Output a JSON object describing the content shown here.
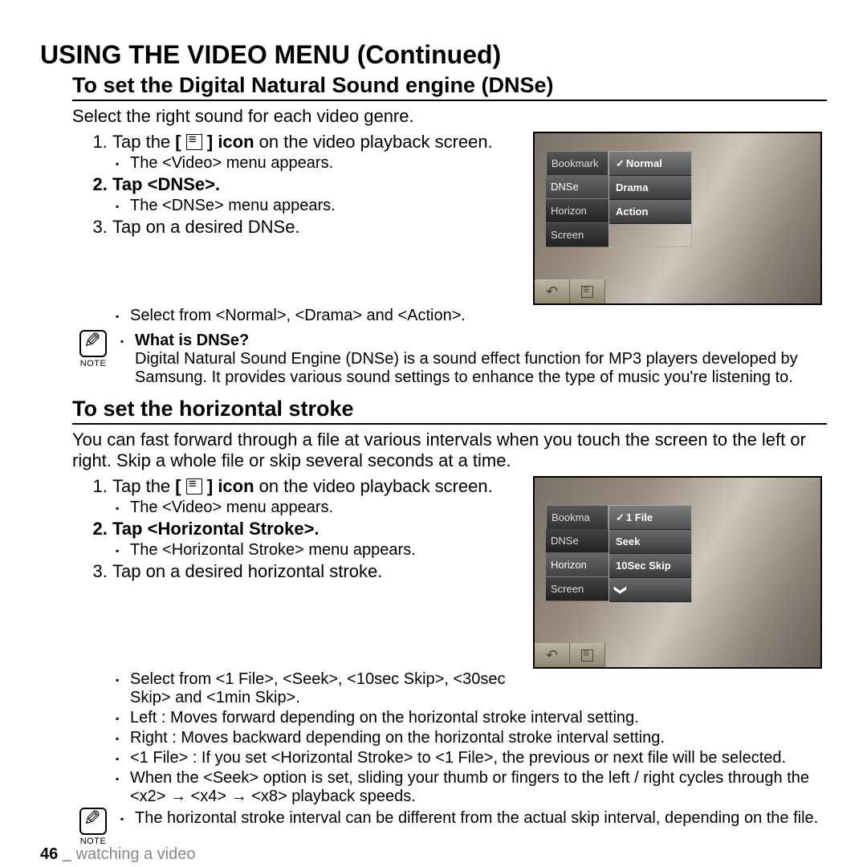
{
  "page_title": "USING THE VIDEO MENU (Continued)",
  "section1": {
    "title": "To set the Digital Natural Sound engine (DNSe)",
    "desc": "Select the right sound for each video genre.",
    "step1a": "Tap the ",
    "step1b": " on the video playback screen.",
    "icon_label": "icon",
    "bracket_l": "[ ",
    "bracket_r": " ]",
    "step1_sub": "The <Video> menu appears.",
    "step2": "Tap <DNSe>.",
    "step2_sub": "The <DNSe> menu appears.",
    "step3": "Tap on a desired DNSe.",
    "step3_sub": "Select from <Normal>, <Drama> and <Action>.",
    "note_title": "What is DNSe?",
    "note_body": "Digital Natural Sound Engine (DNSe) is a sound effect function for MP3 players developed by Samsung. It provides various sound settings to enhance the type of music you're listening to.",
    "note_label": "NOTE",
    "menu_left": [
      "Bookmark",
      "DNSe",
      "Horizon",
      "Screen"
    ],
    "menu_right": [
      "Normal",
      "Drama",
      "Action"
    ],
    "check": "✓"
  },
  "section2": {
    "title": "To set the horizontal stroke",
    "desc": "You can fast forward through a file at various intervals when you touch the screen to the left or right. Skip a whole file or skip several seconds at a time.",
    "step1a": "Tap the ",
    "step1b": " on the video playback screen.",
    "icon_label": "icon",
    "bracket_l": "[ ",
    "bracket_r": " ]",
    "step1_sub": "The <Video> menu appears.",
    "step2": "Tap <Horizontal Stroke>.",
    "step2_sub": "The <Horizontal Stroke> menu appears.",
    "step3": "Tap on a desired horizontal stroke.",
    "step3_subs": [
      "Select from <1 File>, <Seek>, <10sec Skip>, <30sec Skip> and <1min Skip>.",
      "Left : Moves forward depending on the horizontal stroke interval setting.",
      "Right : Moves backward depending on the horizontal stroke interval setting.",
      "<1 File> : If you set <Horizontal Stroke> to <1 File>, the previous or next file will be selected.",
      "When the <Seek> option is set, sliding your thumb or fingers to the left / right cycles through the <x2> → <x4> → <x8> playback speeds."
    ],
    "note_body": "The horizontal stroke interval can be different from the actual skip interval, depending on the file.",
    "note_label": "NOTE",
    "menu_left": [
      "Bookma",
      "DNSe",
      "Horizon",
      "Screen"
    ],
    "menu_right": [
      "1 File",
      "Seek",
      "10Sec Skip"
    ],
    "arrow": "❯",
    "check": "✓"
  },
  "footer": {
    "page": "46",
    "sep": "_",
    "chapter": "watching a video"
  }
}
